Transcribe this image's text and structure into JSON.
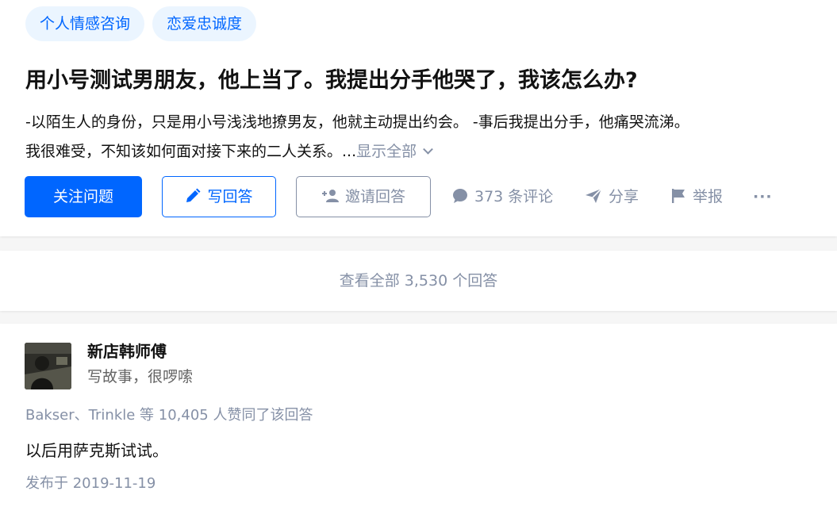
{
  "question": {
    "tags": [
      "个人情感咨询",
      "恋爱忠诚度"
    ],
    "title": "用小号测试男朋友，他上当了。我提出分手他哭了，我该怎么办?",
    "detail_line1": "-以陌生人的身份，只是用小号浅浅地撩男友，他就主动提出约会。 -事后我提出分手，他痛哭流涕。",
    "detail_line2": "我很难受，不知该如何面对接下来的二人关系。...",
    "show_all": "显示全部",
    "actions": {
      "follow": "关注问题",
      "write_answer": "写回答",
      "invite": "邀请回答",
      "comments": "373 条评论",
      "share": "分享",
      "report": "举报",
      "more": "···"
    }
  },
  "view_all": "查看全部 3,530 个回答",
  "answer": {
    "author_name": "新店韩师傅",
    "author_bio": "写故事，很啰嗦",
    "voters": "Bakser、Trinkle 等 10,405 人赞同了该回答",
    "content": "以后用萨克斯试试。",
    "published": "发布于 2019-11-19"
  },
  "colors": {
    "brand_blue": "#0066ff",
    "tag_bg": "#ebf5ff",
    "muted_gray": "#8590a6",
    "page_bg": "#f6f6f6"
  },
  "icons": [
    "pencil-icon",
    "add-user-icon",
    "comment-icon",
    "share-icon",
    "flag-icon",
    "chevron-down-icon"
  ]
}
